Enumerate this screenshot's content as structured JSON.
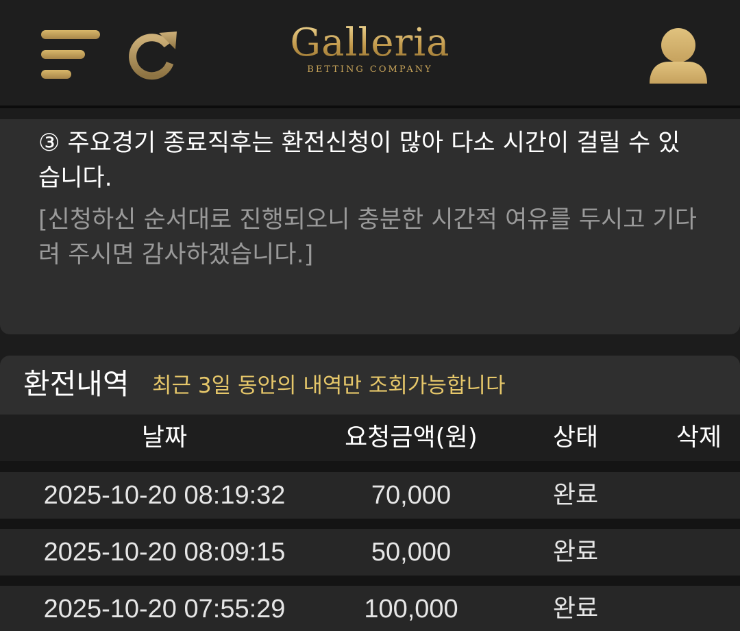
{
  "header": {
    "logo_title": "Galleria",
    "logo_subtitle": "BETTING COMPANY",
    "icons": {
      "menu": "hamburger-menu-icon",
      "refresh": "refresh-icon",
      "user": "user-icon"
    },
    "accent_color": "#c9a55a"
  },
  "notice": {
    "main": "③ 주요경기 종료직후는 환전신청이 많아 다소 시간이 걸릴 수 있습니다.",
    "sub": "[신청하신 순서대로 진행되오니 충분한 시간적 여유를 두시고 기다려 주시면 감사하겠습니다.]"
  },
  "history": {
    "title": "환전내역",
    "note": "최근 3일 동안의 내역만 조회가능합니다",
    "columns": [
      "날짜",
      "요청금액(원)",
      "상태",
      "삭제"
    ],
    "rows": [
      {
        "date": "2025-10-20 08:19:32",
        "amount": "70,000",
        "status": "완료",
        "delete": ""
      },
      {
        "date": "2025-10-20 08:09:15",
        "amount": "50,000",
        "status": "완료",
        "delete": ""
      },
      {
        "date": "2025-10-20 07:55:29",
        "amount": "100,000",
        "status": "완료",
        "delete": ""
      }
    ]
  }
}
